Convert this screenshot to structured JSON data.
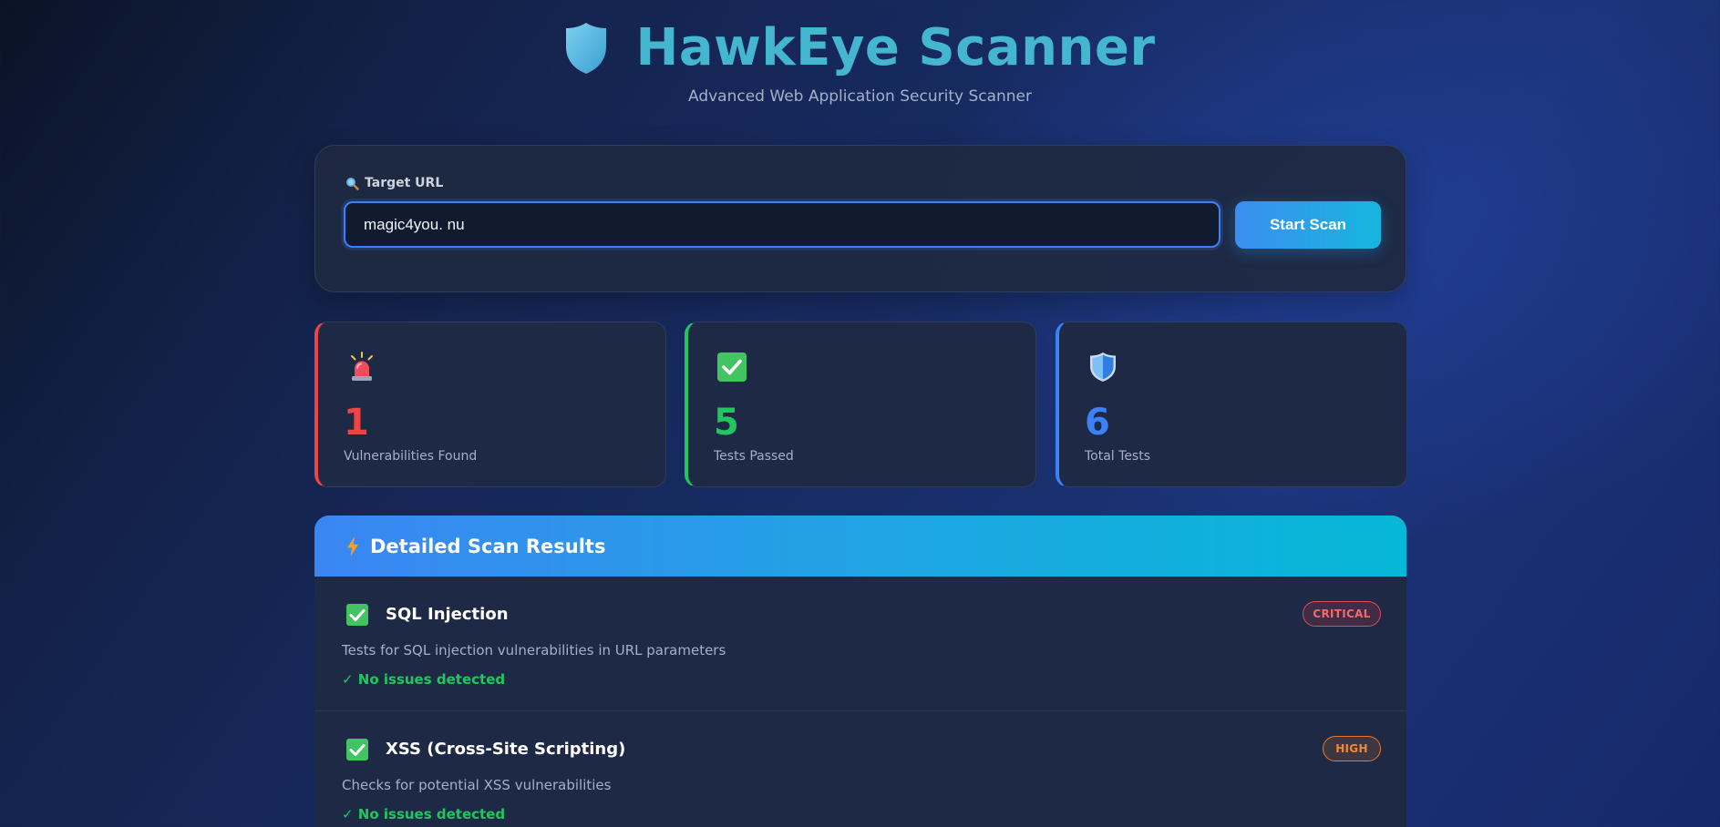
{
  "header": {
    "title": "HawkEye Scanner",
    "subtitle": "Advanced Web Application Security Scanner",
    "logo_icon": "shield-icon"
  },
  "scan_form": {
    "label": "Target URL",
    "label_icon": "magnifier-icon",
    "url_value": "magic4you. nu",
    "button_label": "Start Scan"
  },
  "stats": [
    {
      "icon": "siren-icon",
      "value": "1",
      "label": "Vulnerabilities Found",
      "color": "#ef4444"
    },
    {
      "icon": "check-box-icon",
      "value": "5",
      "label": "Tests Passed",
      "color": "#22c55e"
    },
    {
      "icon": "shield-icon",
      "value": "6",
      "label": "Total Tests",
      "color": "#3b82f6"
    }
  ],
  "results": {
    "title": "Detailed Scan Results",
    "title_icon": "lightning-icon",
    "items": [
      {
        "name": "SQL Injection",
        "severity": "CRITICAL",
        "description": "Tests for SQL injection vulnerabilities in URL parameters",
        "status": "✓ No issues detected"
      },
      {
        "name": "XSS (Cross-Site Scripting)",
        "severity": "HIGH",
        "description": "Checks for potential XSS vulnerabilities",
        "status": "✓ No issues detected"
      }
    ]
  },
  "colors": {
    "accent": "#45b6cf",
    "critical": "#ef4444",
    "passed": "#22c55e",
    "info": "#3b82f6",
    "high": "#f08a3a"
  }
}
